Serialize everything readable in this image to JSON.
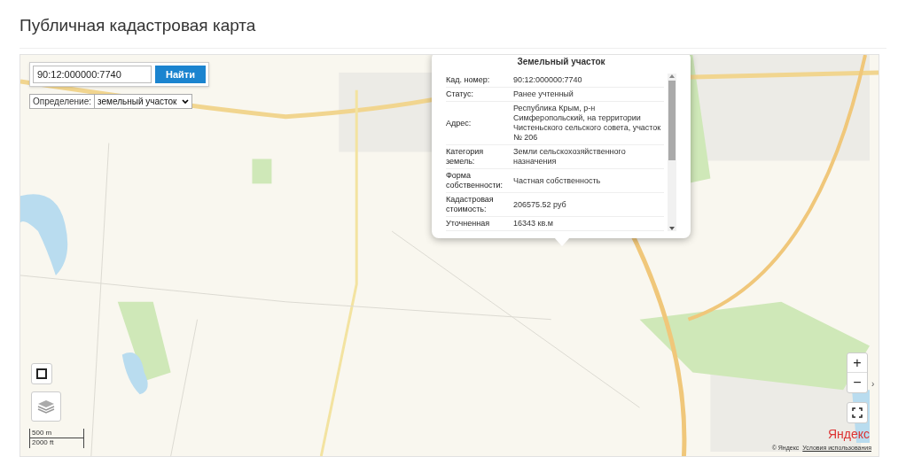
{
  "page": {
    "title": "Публичная кадастровая карта"
  },
  "search": {
    "value": "90:12:000000:7740",
    "button": "Найти"
  },
  "definition": {
    "label": "Определение:",
    "value": "земельный участок"
  },
  "popup": {
    "title": "Земельный участок",
    "rows": [
      {
        "label": "Кад. номер:",
        "value": "90:12:000000:7740"
      },
      {
        "label": "Статус:",
        "value": "Ранее учтенный"
      },
      {
        "label": "Адрес:",
        "value": "Республика Крым, р-н Симферопольский, на территории Чистеньского сельского совета, участок № 206"
      },
      {
        "label": "Категория земель:",
        "value": "Земли сельскохозяйственного назначения"
      },
      {
        "label": "Форма собственности:",
        "value": "Частная собственность"
      },
      {
        "label": "Кадастровая стоимость:",
        "value": "206575.52 руб"
      },
      {
        "label": "Уточненная",
        "value": "16343 кв.м"
      }
    ]
  },
  "scale": {
    "metric": "500 m",
    "imperial": "2000 ft"
  },
  "zoom": {
    "zoom_in": "+",
    "zoom_out": "−"
  },
  "side_toggle": "›",
  "attribution": {
    "logo": "Яндекс",
    "copyright": "© Яндекс",
    "terms_link": "Условия использования"
  }
}
